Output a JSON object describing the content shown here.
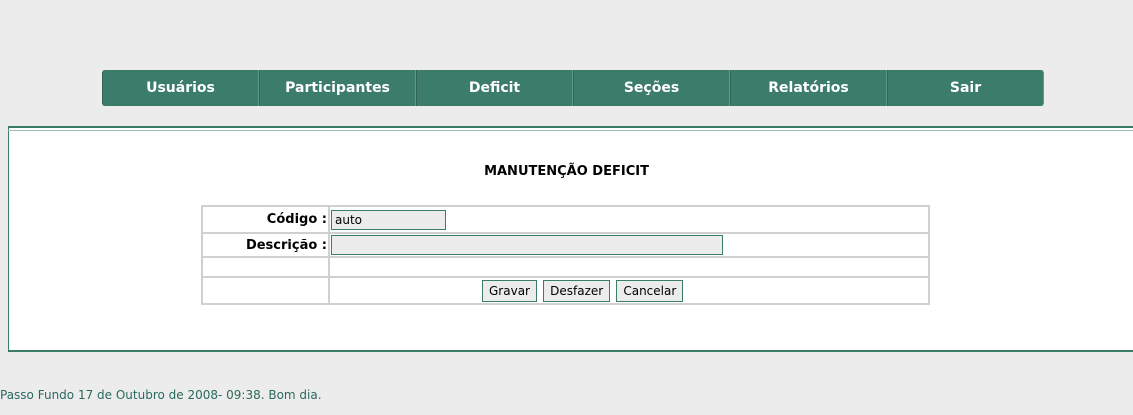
{
  "nav": {
    "items": [
      {
        "label": "Usuários"
      },
      {
        "label": "Participantes"
      },
      {
        "label": "Deficit"
      },
      {
        "label": "Seções"
      },
      {
        "label": "Relatórios"
      },
      {
        "label": "Sair"
      }
    ]
  },
  "main": {
    "title": "MANUTENÇÃO DEFICIT",
    "form": {
      "codigo_label": "Código :",
      "codigo_value": "auto",
      "descricao_label": "Descrição :",
      "descricao_value": ""
    },
    "buttons": {
      "gravar": "Gravar",
      "desfazer": "Desfazer",
      "cancelar": "Cancelar"
    }
  },
  "footer": {
    "text": "Passo Fundo 17 de Outubro de 2008- 09:38. Bom dia."
  },
  "colors": {
    "accent": "#3c7c6b",
    "background": "#ececec"
  }
}
